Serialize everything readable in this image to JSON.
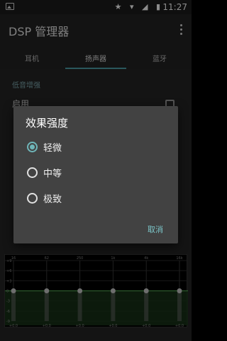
{
  "status_bar": {
    "time": "11:27",
    "icons": [
      "star-icon",
      "wifi-icon",
      "signal-icon",
      "battery-icon"
    ]
  },
  "app_bar": {
    "title": "DSP 管理器"
  },
  "tabs": [
    {
      "label": "耳机",
      "active": false
    },
    {
      "label": "扬声器",
      "active": true
    },
    {
      "label": "蓝牙",
      "active": false
    }
  ],
  "content": {
    "section_header": "低音增强",
    "enable_label": "启用"
  },
  "equalizer": {
    "freq_labels": [
      "16",
      "62",
      "250",
      "1k",
      "4k",
      "16k"
    ],
    "db_labels": [
      "+9",
      "+6",
      "+3",
      "0",
      "-3",
      "-6",
      "-9"
    ],
    "band_values": [
      "+0.0",
      "+0.0",
      "+0.0",
      "+0.0",
      "+0.0",
      "+0.0"
    ],
    "accent_color": "#4fa04f"
  },
  "dialog": {
    "title": "效果强度",
    "options": [
      {
        "label": "轻微",
        "checked": true
      },
      {
        "label": "中等",
        "checked": false
      },
      {
        "label": "极致",
        "checked": false
      }
    ],
    "cancel_label": "取消",
    "accent_color": "#6fb5b8"
  }
}
